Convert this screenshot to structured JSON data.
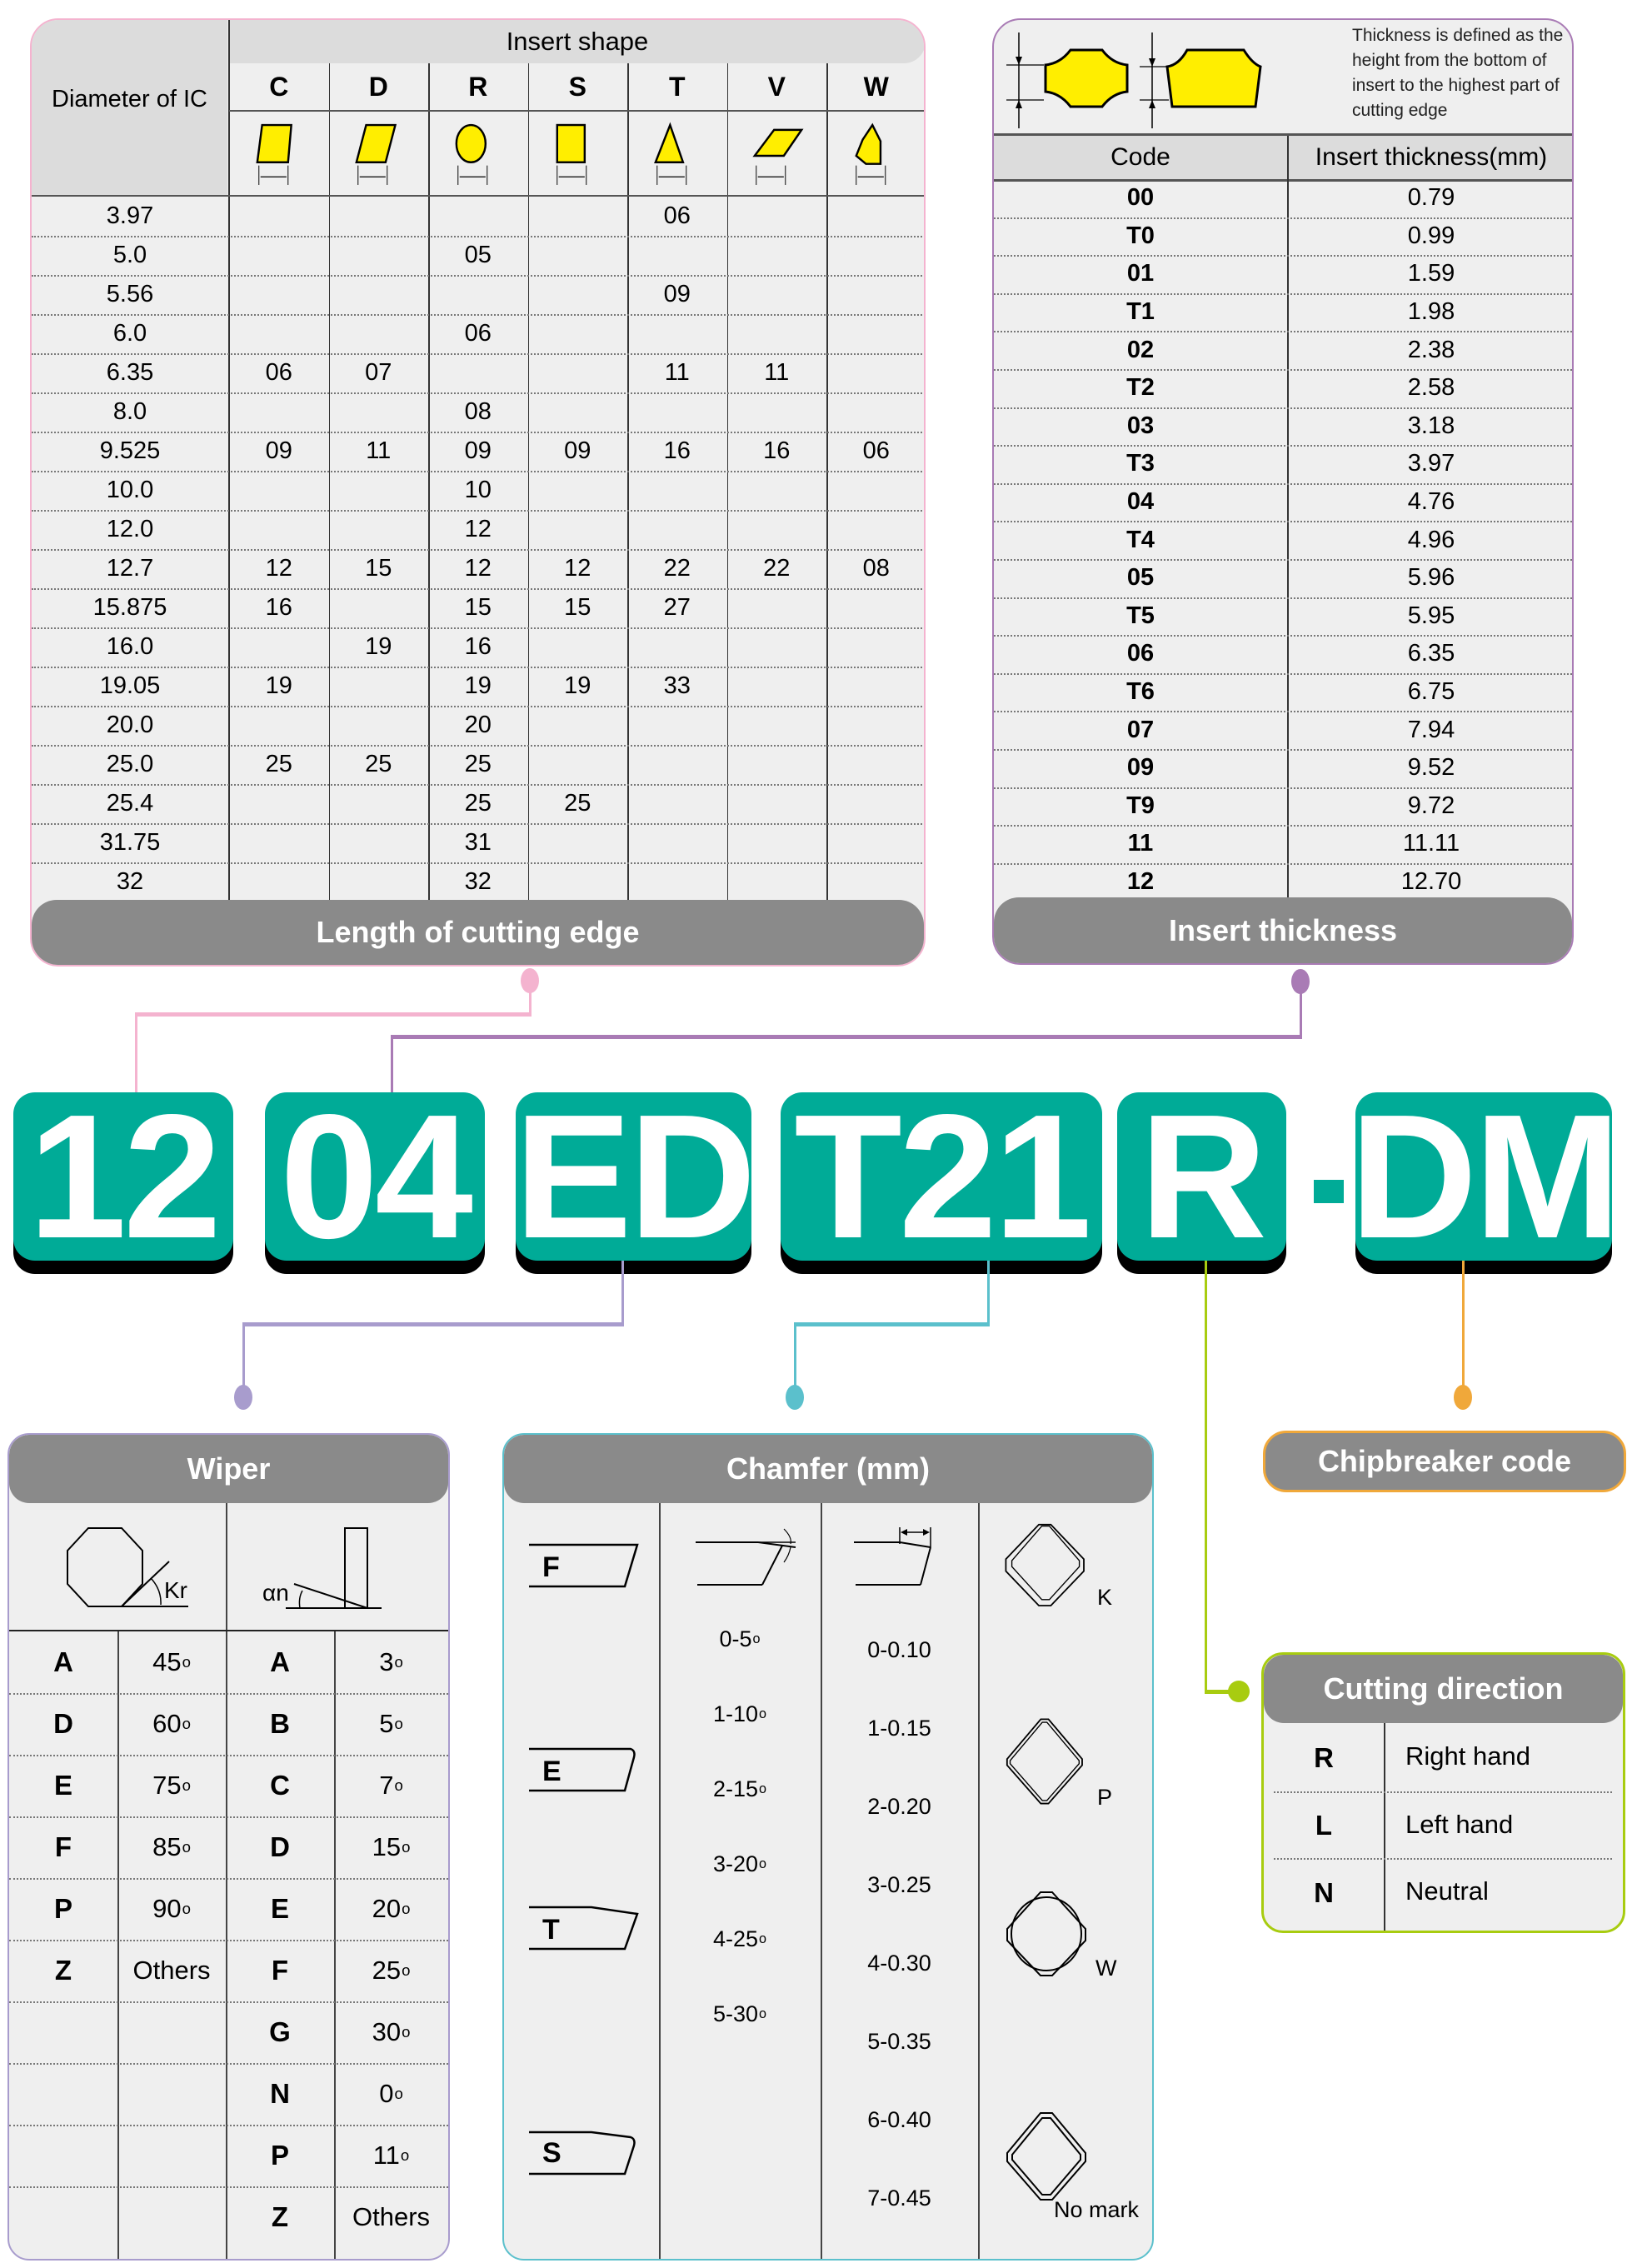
{
  "code_string": {
    "blocks": [
      "12",
      "04",
      "ED",
      "T21",
      "R",
      "DM"
    ],
    "separator": "-",
    "block_color": "#00ab97"
  },
  "length_table": {
    "ic_header": "Diameter of IC",
    "shape_header": "Insert shape",
    "shapes": [
      "C",
      "D",
      "R",
      "S",
      "T",
      "V",
      "W"
    ],
    "rows": [
      {
        "ic": "3.97",
        "values": [
          "",
          "",
          "",
          "",
          "06",
          "",
          ""
        ]
      },
      {
        "ic": "5.0",
        "values": [
          "",
          "",
          "05",
          "",
          "",
          "",
          ""
        ]
      },
      {
        "ic": "5.56",
        "values": [
          "",
          "",
          "",
          "",
          "09",
          "",
          ""
        ]
      },
      {
        "ic": "6.0",
        "values": [
          "",
          "",
          "06",
          "",
          "",
          "",
          ""
        ]
      },
      {
        "ic": "6.35",
        "values": [
          "06",
          "07",
          "",
          "",
          "11",
          "11",
          ""
        ]
      },
      {
        "ic": "8.0",
        "values": [
          "",
          "",
          "08",
          "",
          "",
          "",
          ""
        ]
      },
      {
        "ic": "9.525",
        "values": [
          "09",
          "11",
          "09",
          "09",
          "16",
          "16",
          "06"
        ]
      },
      {
        "ic": "10.0",
        "values": [
          "",
          "",
          "10",
          "",
          "",
          "",
          ""
        ]
      },
      {
        "ic": "12.0",
        "values": [
          "",
          "",
          "12",
          "",
          "",
          "",
          ""
        ]
      },
      {
        "ic": "12.7",
        "values": [
          "12",
          "15",
          "12",
          "12",
          "22",
          "22",
          "08"
        ]
      },
      {
        "ic": "15.875",
        "values": [
          "16",
          "",
          "15",
          "15",
          "27",
          "",
          ""
        ]
      },
      {
        "ic": "16.0",
        "values": [
          "",
          "19",
          "16",
          "",
          "",
          "",
          ""
        ]
      },
      {
        "ic": "19.05",
        "values": [
          "19",
          "",
          "19",
          "19",
          "33",
          "",
          ""
        ]
      },
      {
        "ic": "20.0",
        "values": [
          "",
          "",
          "20",
          "",
          "",
          "",
          ""
        ]
      },
      {
        "ic": "25.0",
        "values": [
          "25",
          "25",
          "25",
          "",
          "",
          "",
          ""
        ]
      },
      {
        "ic": "25.4",
        "values": [
          "",
          "",
          "25",
          "25",
          "",
          "",
          ""
        ]
      },
      {
        "ic": "31.75",
        "values": [
          "",
          "",
          "31",
          "",
          "",
          "",
          ""
        ]
      },
      {
        "ic": "32",
        "values": [
          "",
          "",
          "32",
          "",
          "",
          "",
          ""
        ]
      }
    ],
    "footer": "Length of cutting edge",
    "border_color": "#f4b3cf"
  },
  "thickness_table": {
    "note": "Thickness is defined as the height from the bottom of insert to the highest part of cutting edge",
    "col_code": "Code",
    "col_value": "Insert thickness(mm)",
    "rows": [
      {
        "code": "00",
        "value": "0.79"
      },
      {
        "code": "T0",
        "value": "0.99"
      },
      {
        "code": "01",
        "value": "1.59"
      },
      {
        "code": "T1",
        "value": "1.98"
      },
      {
        "code": "02",
        "value": "2.38"
      },
      {
        "code": "T2",
        "value": "2.58"
      },
      {
        "code": "03",
        "value": "3.18"
      },
      {
        "code": "T3",
        "value": "3.97"
      },
      {
        "code": "04",
        "value": "4.76"
      },
      {
        "code": "T4",
        "value": "4.96"
      },
      {
        "code": "05",
        "value": "5.96"
      },
      {
        "code": "T5",
        "value": "5.95"
      },
      {
        "code": "06",
        "value": "6.35"
      },
      {
        "code": "T6",
        "value": "6.75"
      },
      {
        "code": "07",
        "value": "7.94"
      },
      {
        "code": "09",
        "value": "9.52"
      },
      {
        "code": "T9",
        "value": "9.72"
      },
      {
        "code": "11",
        "value": "11.11"
      },
      {
        "code": "12",
        "value": "12.70"
      }
    ],
    "footer": "Insert thickness",
    "border_color": "#a97bb5"
  },
  "wiper": {
    "title": "Wiper",
    "kr_label": "Kr",
    "an_label": "αn",
    "kr_rows": [
      {
        "code": "A",
        "value": "45",
        "deg": true
      },
      {
        "code": "D",
        "value": "60",
        "deg": true
      },
      {
        "code": "E",
        "value": "75",
        "deg": true
      },
      {
        "code": "F",
        "value": "85",
        "deg": true
      },
      {
        "code": "P",
        "value": "90",
        "deg": true
      },
      {
        "code": "Z",
        "value": "Others",
        "deg": false
      },
      {
        "code": "",
        "value": "",
        "deg": false
      },
      {
        "code": "",
        "value": "",
        "deg": false
      },
      {
        "code": "",
        "value": "",
        "deg": false
      },
      {
        "code": "",
        "value": "",
        "deg": false
      }
    ],
    "an_rows": [
      {
        "code": "A",
        "value": "3",
        "deg": true
      },
      {
        "code": "B",
        "value": "5",
        "deg": true
      },
      {
        "code": "C",
        "value": "7",
        "deg": true
      },
      {
        "code": "D",
        "value": "15",
        "deg": true
      },
      {
        "code": "E",
        "value": "20",
        "deg": true
      },
      {
        "code": "F",
        "value": "25",
        "deg": true
      },
      {
        "code": "G",
        "value": "30",
        "deg": true
      },
      {
        "code": "N",
        "value": "0",
        "deg": true
      },
      {
        "code": "P",
        "value": "11",
        "deg": true
      },
      {
        "code": "Z",
        "value": "Others",
        "deg": false
      }
    ],
    "degree_symbol": "o",
    "border_color": "#a89ccd"
  },
  "chamfer": {
    "title": "Chamfer (mm)",
    "types": [
      "F",
      "E",
      "T",
      "S"
    ],
    "angles": [
      "0-5",
      "1-10",
      "2-15",
      "3-20",
      "4-25",
      "5-30"
    ],
    "widths": [
      "0-0.10",
      "1-0.15",
      "2-0.20",
      "3-0.25",
      "4-0.30",
      "5-0.35",
      "6-0.40",
      "7-0.45"
    ],
    "marks": [
      "K",
      "P",
      "W",
      "No mark"
    ],
    "degree_symbol": "o",
    "border_color": "#5bc0cc"
  },
  "chipbreaker": {
    "title": "Chipbreaker code",
    "border_color": "#f0a83a"
  },
  "cutting_direction": {
    "title": "Cutting direction",
    "rows": [
      {
        "code": "R",
        "label": "Right hand"
      },
      {
        "code": "L",
        "label": "Left hand"
      },
      {
        "code": "N",
        "label": "Neutral"
      }
    ],
    "border_color": "#a8cc10"
  }
}
